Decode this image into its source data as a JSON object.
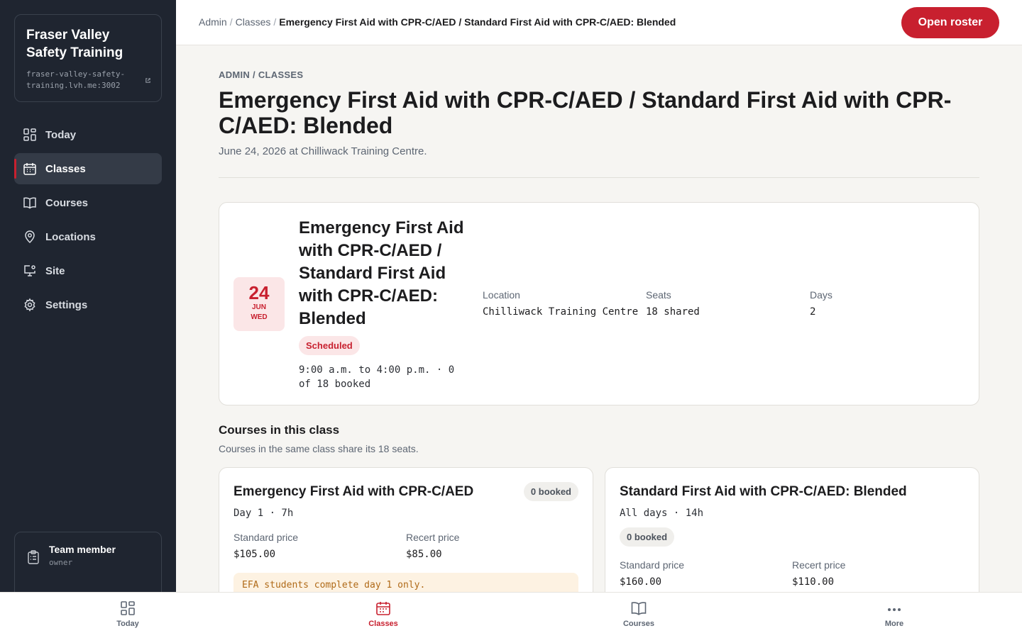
{
  "sidebar": {
    "brand_name": "Fraser Valley Safety Training",
    "brand_domain": "fraser-valley-safety-training.lvh.me:3002",
    "items": [
      {
        "label": "Today",
        "icon": "dashboard-icon"
      },
      {
        "label": "Classes",
        "icon": "calendar-icon",
        "active": true
      },
      {
        "label": "Courses",
        "icon": "book-icon"
      },
      {
        "label": "Locations",
        "icon": "map-pin-icon"
      },
      {
        "label": "Site",
        "icon": "monitor-gear-icon"
      },
      {
        "label": "Settings",
        "icon": "gear-icon"
      }
    ],
    "user": {
      "name": "Team member",
      "role": "owner"
    }
  },
  "topbar": {
    "crumb_admin": "Admin",
    "crumb_classes": "Classes",
    "crumb_current": "Emergency First Aid with CPR-C/AED / Standard First Aid with CPR-C/AED: Blended",
    "open_roster": "Open roster"
  },
  "header": {
    "eyebrow": "ADMIN / CLASSES",
    "title": "Emergency First Aid with CPR-C/AED / Standard First Aid with CPR-C/AED: Blended",
    "subtitle": "June 24, 2026 at Chilliwack Training Centre."
  },
  "class_card": {
    "day": "24",
    "month": "JUN",
    "weekday": "WED",
    "title": "Emergency First Aid with CPR-C/AED / Standard First Aid with CPR-C/AED: Blended",
    "status": "Scheduled",
    "time": "9:00 a.m. to 4:00 p.m. · 0 of 18 booked",
    "location_label": "Location",
    "location_value": "Chilliwack Training Centre",
    "seats_label": "Seats",
    "seats_value": "18 shared",
    "days_label": "Days",
    "days_value": "2"
  },
  "courses_section": {
    "title": "Courses in this class",
    "subtitle": "Courses in the same class share its 18 seats."
  },
  "courses": [
    {
      "title": "Emergency First Aid with CPR-C/AED",
      "booked": "0 booked",
      "duration": "Day 1 · 7h",
      "standard_label": "Standard price",
      "standard_value": "$105.00",
      "recert_label": "Recert price",
      "recert_value": "$85.00",
      "notice": "EFA students complete day 1 only."
    },
    {
      "title": "Standard First Aid with CPR-C/AED: Blended",
      "booked": "0 booked",
      "duration": "All days · 14h",
      "standard_label": "Standard price",
      "standard_value": "$160.00",
      "recert_label": "Recert price",
      "recert_value": "$110.00"
    }
  ],
  "bottom_nav": [
    {
      "label": "Today",
      "icon": "dashboard-icon"
    },
    {
      "label": "Classes",
      "icon": "calendar-icon",
      "active": true
    },
    {
      "label": "Courses",
      "icon": "book-icon"
    },
    {
      "label": "More",
      "icon": "more-icon"
    }
  ],
  "colors": {
    "accent": "#c8202f",
    "sidebar_bg": "#1f2530",
    "page_bg": "#f6f5f2"
  }
}
